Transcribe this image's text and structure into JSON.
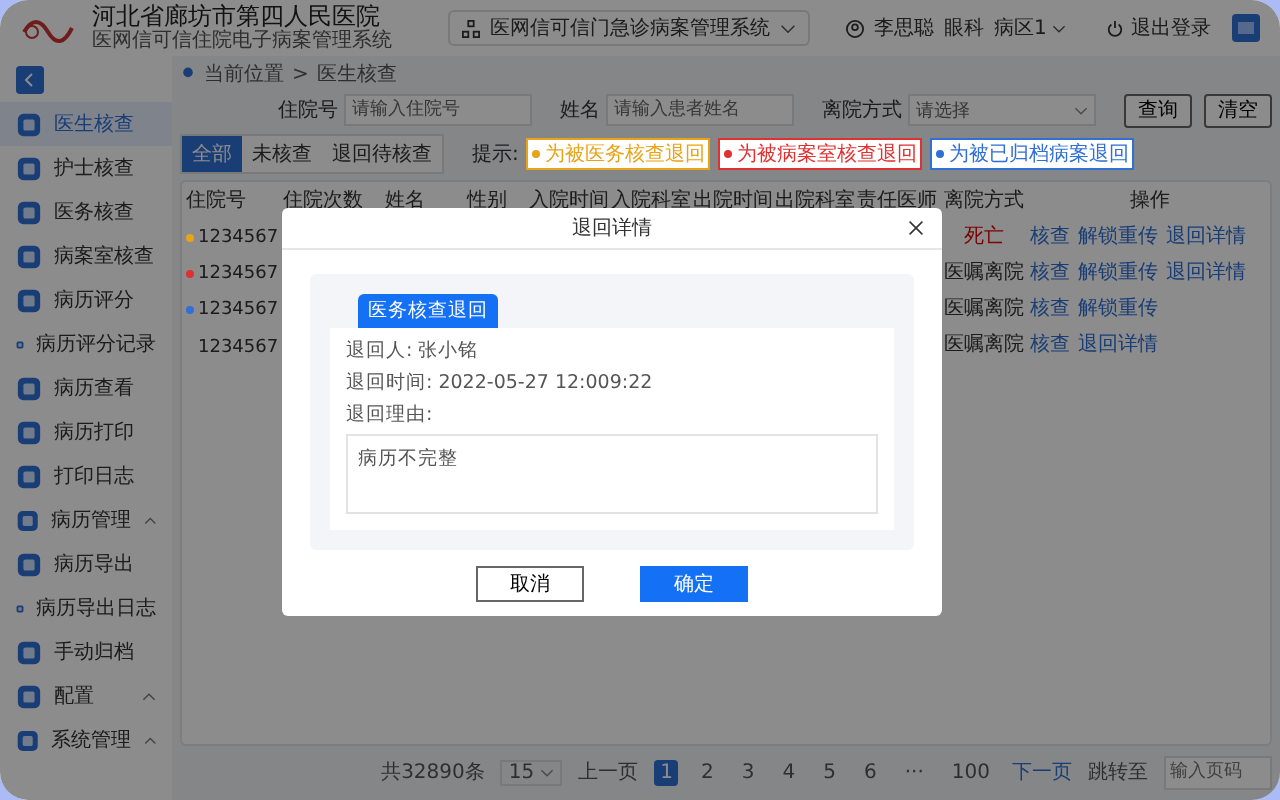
{
  "header": {
    "hospital": "河北省廊坊市第四人民医院",
    "subtitle": "医网信可信住院电子病案管理系统",
    "system_select": "医网信可信门急诊病案管理系统",
    "user": "李思聪",
    "department": "眼科",
    "ward": "病区1",
    "logout": "退出登录"
  },
  "sidebar": {
    "items": [
      {
        "label": "医生核查",
        "kind": "link",
        "selected": true
      },
      {
        "label": "护士核查",
        "kind": "link",
        "selected": false
      },
      {
        "label": "医务核查",
        "kind": "link",
        "selected": false
      },
      {
        "label": "病案室核查",
        "kind": "link",
        "selected": false
      },
      {
        "label": "病历评分",
        "kind": "link",
        "selected": false
      },
      {
        "label": "病历评分记录",
        "kind": "link",
        "selected": false
      },
      {
        "label": "病历查看",
        "kind": "link",
        "selected": false
      },
      {
        "label": "病历打印",
        "kind": "link",
        "selected": false
      },
      {
        "label": "打印日志",
        "kind": "link",
        "selected": false
      },
      {
        "label": "病历管理",
        "kind": "group",
        "expanded": true,
        "selected": false
      },
      {
        "label": "病历导出",
        "kind": "link",
        "selected": false
      },
      {
        "label": "病历导出日志",
        "kind": "link",
        "selected": false
      },
      {
        "label": "手动归档",
        "kind": "link",
        "selected": false
      },
      {
        "label": "配置",
        "kind": "group",
        "expanded": true,
        "selected": false
      },
      {
        "label": "系统管理",
        "kind": "group",
        "expanded": true,
        "selected": false
      }
    ]
  },
  "breadcrumb": [
    "当前位置",
    "医生核查"
  ],
  "breadcrumb_separator": ">",
  "filters": [
    {
      "label": "住院号",
      "placeholder": "请输入住院号",
      "kind": "input"
    },
    {
      "label": "姓名",
      "placeholder": "请输入患者姓名",
      "kind": "input"
    },
    {
      "label": "离院方式",
      "placeholder": "请选择",
      "kind": "select"
    }
  ],
  "filter_buttons": [
    "查询",
    "清空"
  ],
  "tabs": [
    {
      "label": "全部",
      "selected": true
    },
    {
      "label": "未核查",
      "selected": false
    },
    {
      "label": "退回待核查",
      "selected": false
    }
  ],
  "hint": {
    "label": "提示:",
    "tags": [
      {
        "text": "为被医务核查退回",
        "color": "#e8a317"
      },
      {
        "text": "为被病案室核查退回",
        "color": "#e03131"
      },
      {
        "text": "为被已归档病案退回",
        "color": "#2f6fd6"
      }
    ]
  },
  "table": {
    "columns": [
      "住院号",
      "住院次数",
      "姓名",
      "性别",
      "入院时间",
      "入院科室",
      "出院时间",
      "出院科室",
      "责任医师",
      "离院方式",
      "操作"
    ],
    "rows": [
      {
        "id": "1234567",
        "color": "#e8a317",
        "discharge": "死亡",
        "alert": true,
        "actions": [
          "核查",
          "解锁重传",
          "退回详情"
        ]
      },
      {
        "id": "1234567",
        "color": "#e03131",
        "discharge": "医嘱离院",
        "alert": false,
        "actions": [
          "核查",
          "解锁重传",
          "退回详情"
        ]
      },
      {
        "id": "1234567",
        "color": "#2f6fd6",
        "discharge": "医嘱离院",
        "alert": false,
        "actions": [
          "核查",
          "解锁重传"
        ]
      },
      {
        "id": "1234567",
        "discharge": "医嘱离院",
        "alert": false,
        "actions": [
          "核查",
          "退回详情"
        ]
      }
    ]
  },
  "pagination": {
    "total": "共32890条",
    "page_size": "15",
    "prev": "上一页",
    "pages": [
      {
        "label": "1",
        "selected": true
      },
      {
        "label": "2",
        "selected": false
      },
      {
        "label": "3",
        "selected": false
      },
      {
        "label": "4",
        "selected": false
      },
      {
        "label": "5",
        "selected": false
      },
      {
        "label": "6",
        "selected": false
      },
      {
        "label": "···",
        "selected": false
      },
      {
        "label": "100",
        "selected": false
      }
    ],
    "next": "下一页",
    "jump_label": "跳转至",
    "jump_placeholder": "输入页码"
  },
  "dialog": {
    "title": "退回详情",
    "tab": "医务核查退回",
    "returner": "退回人: 张小铭",
    "time": "退回时间: 2022-05-27 12:009:22",
    "reason_label": "退回理由:",
    "reason": "病历不完整",
    "buttons": [
      {
        "label": "取消",
        "kind": "secondary"
      },
      {
        "label": "确定",
        "kind": "primary"
      }
    ]
  }
}
